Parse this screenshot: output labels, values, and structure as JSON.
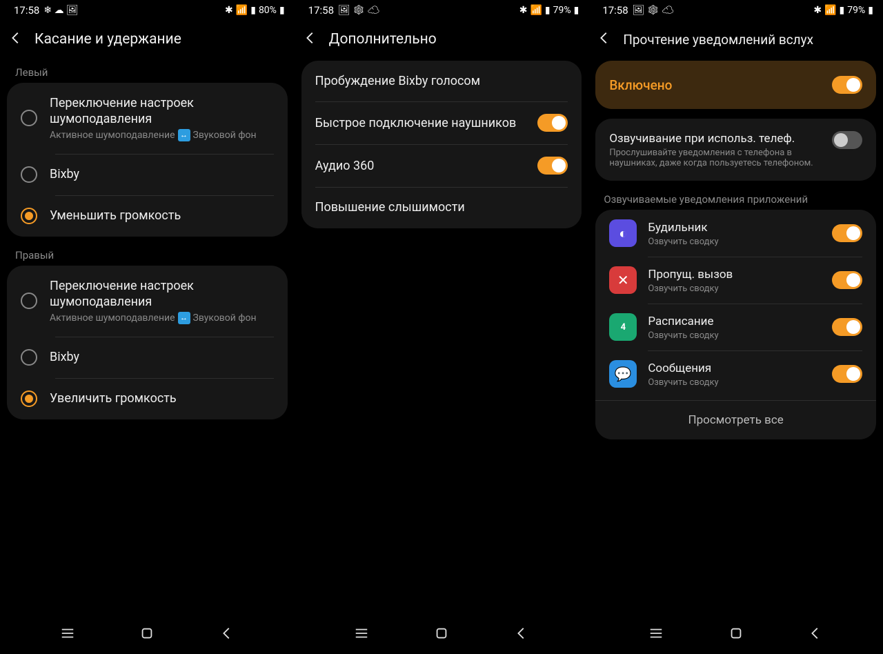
{
  "screen1": {
    "status": {
      "time": "17:58",
      "battery": "80%"
    },
    "title": "Касание и удержание",
    "left_label": "Левый",
    "right_label": "Правый",
    "opts": {
      "noise_title": "Переключение настроек шумоподавления",
      "noise_sub_a": "Активное шумоподавление",
      "noise_sub_b": "Звуковой фон",
      "bixby": "Bixby",
      "vol_down": "Уменьшить громкость",
      "vol_up": "Увеличить громкость"
    }
  },
  "screen2": {
    "status": {
      "time": "17:58",
      "battery": "79%"
    },
    "title": "Дополнительно",
    "items": {
      "bixby_wake": "Пробуждение Bixby голосом",
      "quick_connect": "Быстрое подключение наушников",
      "audio360": "Аудио 360",
      "hearing": "Повышение слышимости"
    }
  },
  "screen3": {
    "status": {
      "time": "17:58",
      "battery": "79%"
    },
    "title": "Прочтение уведомлений вслух",
    "master": "Включено",
    "phone_use_title": "Озвучивание при использ. телеф.",
    "phone_use_sub": "Прослушивайте уведомления с телефона в наушниках, даже когда пользуетесь телефоном.",
    "apps_label": "Озвучиваемые уведомления приложений",
    "summary": "Озвучить сводку",
    "apps": {
      "alarm": "Будильник",
      "missed": "Пропущ. вызов",
      "schedule": "Расписание",
      "messages": "Сообщения"
    },
    "view_all": "Просмотреть все"
  }
}
